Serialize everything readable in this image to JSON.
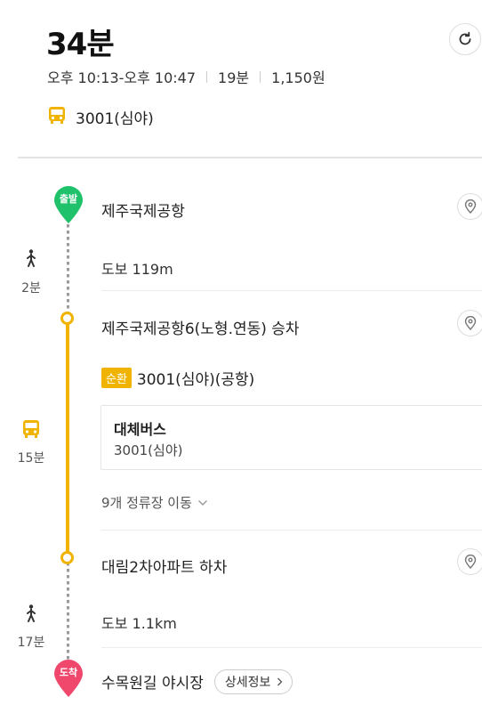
{
  "summary": {
    "duration": "34분",
    "time_range": "오후 10:13-오후 10:47",
    "ride_time": "19분",
    "fare": "1,150원",
    "bus_route": "3001(심야)"
  },
  "icons": {
    "refresh": "refresh-icon",
    "bus": "bus-icon",
    "walk": "walk-icon",
    "location": "location-pin-icon",
    "chevron": "chevron-down-icon"
  },
  "colors": {
    "start_pin": "#1fc16b",
    "end_pin": "#f0476d",
    "bus_line": "#f0b400",
    "walk_line": "#9a9a9a"
  },
  "steps": {
    "start": {
      "pin_label": "출발",
      "name": "제주국제공항"
    },
    "walk1": {
      "time": "2분",
      "distance": "도보 119m"
    },
    "board": {
      "name": "제주국제공항6(노형.연동) 승차"
    },
    "bus": {
      "badge": "순환",
      "route_label": "3001(심야)(공항)",
      "time": "15분",
      "alt_title": "대체버스",
      "alt_route": "3001(심야)",
      "stops_text": "9개 정류장 이동"
    },
    "alight": {
      "name": "대림2차아파트 하차"
    },
    "walk2": {
      "time": "17분",
      "distance": "도보 1.1km"
    },
    "end": {
      "pin_label": "도착",
      "name": "수목원길 야시장",
      "detail_button": "상세정보"
    }
  }
}
